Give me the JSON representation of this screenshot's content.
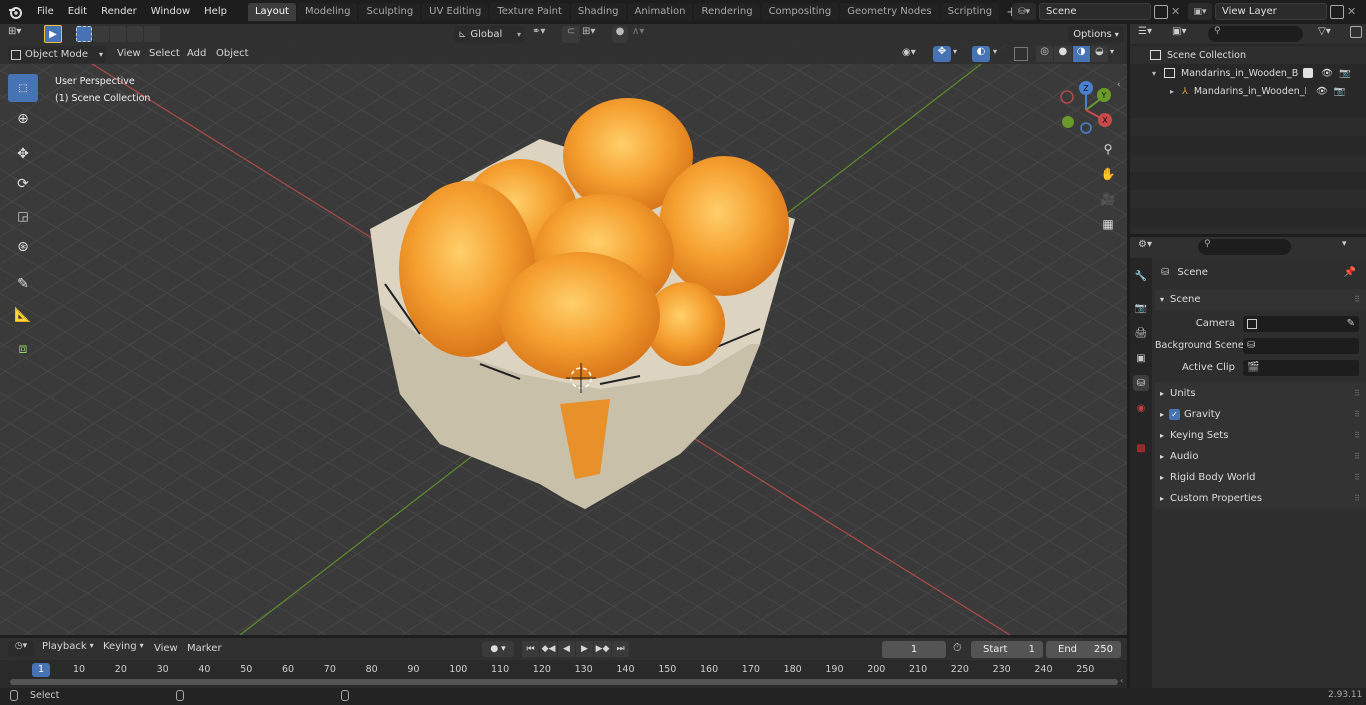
{
  "menus": [
    "File",
    "Edit",
    "Render",
    "Window",
    "Help"
  ],
  "workspaces": [
    "Layout",
    "Modeling",
    "Sculpting",
    "UV Editing",
    "Texture Paint",
    "Shading",
    "Animation",
    "Rendering",
    "Compositing",
    "Geometry Nodes",
    "Scripting"
  ],
  "active_workspace": "Layout",
  "scene_field": "Scene",
  "view_layer_field": "View Layer",
  "toolbar": {
    "transform_orientation": "Global",
    "options_label": "Options"
  },
  "viewport_header": {
    "mode": "Object Mode",
    "menus": [
      "View",
      "Select",
      "Add",
      "Object"
    ]
  },
  "viewport_overlay": {
    "perspective": "User Perspective",
    "collection": "(1) Scene Collection"
  },
  "gizmo_axes": {
    "x": "X",
    "y": "Y",
    "z": "Z"
  },
  "outliner": {
    "scene_collection": "Scene Collection",
    "items": [
      {
        "label": "Mandarins_in_Wooden_Baske"
      },
      {
        "label": "Mandarins_in_Wooden_B"
      }
    ]
  },
  "properties": {
    "context": "Scene",
    "panel_title": "Scene",
    "fields": {
      "camera": "Camera",
      "background_scene": "Background Scene",
      "active_clip": "Active Clip"
    },
    "sections": [
      "Units",
      "Gravity",
      "Keying Sets",
      "Audio",
      "Rigid Body World",
      "Custom Properties"
    ]
  },
  "timeline": {
    "menus": [
      "Playback",
      "Keying",
      "View",
      "Marker"
    ],
    "current_frame": "1",
    "start_label": "Start",
    "start": "1",
    "end_label": "End",
    "end": "250",
    "ticks": [
      "10",
      "20",
      "30",
      "40",
      "50",
      "60",
      "70",
      "80",
      "90",
      "100",
      "110",
      "120",
      "130",
      "140",
      "150",
      "160",
      "170",
      "180",
      "190",
      "200",
      "210",
      "220",
      "230",
      "240",
      "250"
    ],
    "frame_badge": "1"
  },
  "status": {
    "left": "Select",
    "version": "2.93.11"
  },
  "colors": {
    "accent": "#4772b3",
    "x_axis": "#c84a4a",
    "y_axis": "#6a9a2a",
    "z_axis": "#4a80d0",
    "mandarin": "#f0a030"
  }
}
